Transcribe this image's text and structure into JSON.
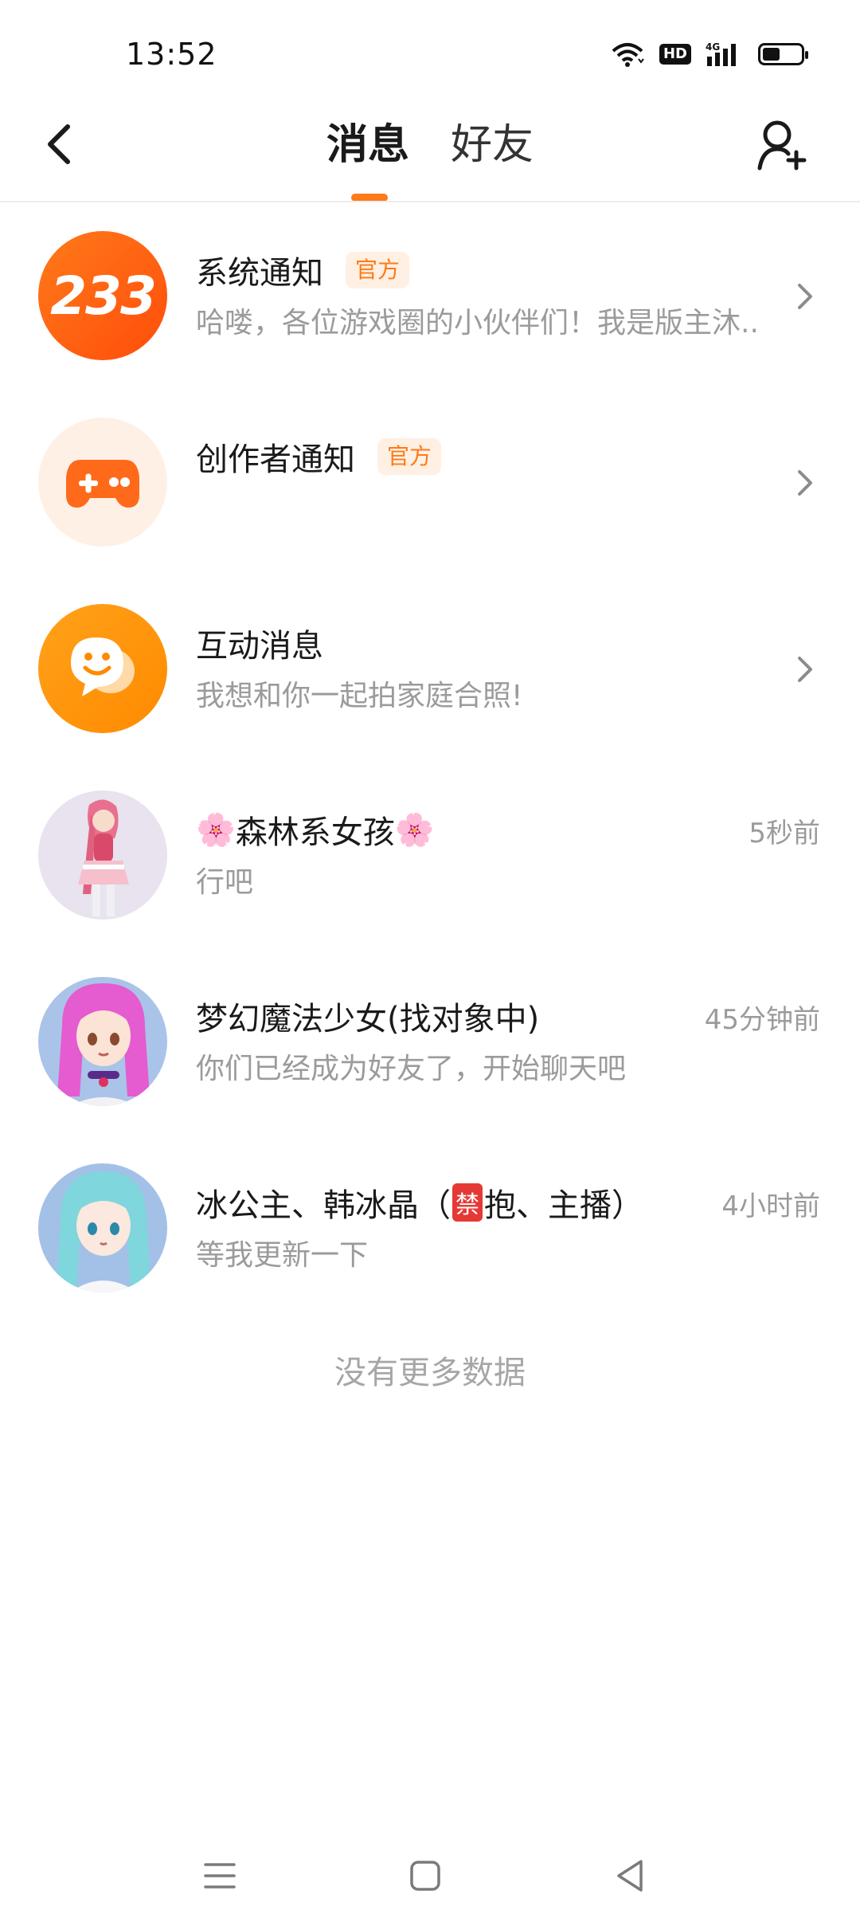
{
  "status_bar": {
    "time": "13:52",
    "network": "4G",
    "hd": "HD",
    "battery_level": 0.45
  },
  "header": {
    "tabs": [
      {
        "label": "消息",
        "active": true
      },
      {
        "label": "好友",
        "active": false
      }
    ],
    "accent_color": "#ff7a1a"
  },
  "conversations": [
    {
      "name": "系统通知",
      "badge": "官方",
      "preview": "哈喽，各位游戏圈的小伙伴们！我是版主沐...",
      "time": "",
      "avatar": "233-logo",
      "avatar_text": "233"
    },
    {
      "name": "创作者通知",
      "badge": "官方",
      "preview": "",
      "time": "",
      "avatar": "gamepad-icon"
    },
    {
      "name": "互动消息",
      "badge": "",
      "preview": "我想和你一起拍家庭合照!",
      "time": "",
      "avatar": "chat-bubble-icon"
    },
    {
      "name_prefix": "🌸",
      "name": "森林系女孩",
      "name_suffix": "🌸",
      "preview": "行吧",
      "time": "5秒前",
      "avatar": "avatar-pink-hair-girl"
    },
    {
      "name": "梦幻魔法少女(找对象中)",
      "preview": "你们已经成为好友了，开始聊天吧",
      "time": "45分钟前",
      "avatar": "avatar-magenta-hair-girl"
    },
    {
      "name_start": "冰公主、韩冰晶（",
      "name_emoji": "禁",
      "name_end": "抱、主播）",
      "preview": "等我更新一下",
      "time": "4小时前",
      "avatar": "avatar-cyan-hair-girl"
    }
  ],
  "footer": {
    "no_more_text": "没有更多数据"
  },
  "colors": {
    "badge_bg": "#fff0e3",
    "badge_text": "#ff7a1a",
    "forbidden_bg": "#e53935"
  },
  "nav_bar": {
    "buttons": [
      "menu-icon",
      "home-square-icon",
      "back-triangle-icon"
    ]
  }
}
